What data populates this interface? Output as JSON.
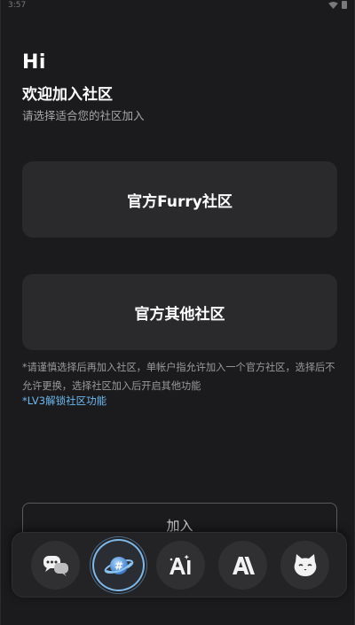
{
  "status": {
    "time": "3:57"
  },
  "header": {
    "greeting": "Hi",
    "title": "欢迎加入社区",
    "subtitle": "请选择适合您的社区加入"
  },
  "options": [
    {
      "label": "官方Furry社区"
    },
    {
      "label": "官方其他社区"
    }
  ],
  "notice": {
    "text": "*请谨慎选择后再加入社区，单帐户指允许加入一个官方社区，选择后不允许更换，选择社区加入后开启其他功能",
    "link": "*LV3解锁社区功能"
  },
  "join": {
    "label": "加入"
  },
  "dock": {
    "apps": [
      {
        "icon": "chat-bubbles-icon"
      },
      {
        "icon": "planet-hash-icon",
        "active": true
      },
      {
        "icon": "ai-sparkle-icon"
      },
      {
        "icon": "anthropic-logo-icon"
      },
      {
        "icon": "cat-face-icon"
      }
    ]
  },
  "colors": {
    "background": "#1b1b1d",
    "card": "#2a2a2c",
    "link": "#6db8f0",
    "active_ring": "#7fb8e8"
  }
}
